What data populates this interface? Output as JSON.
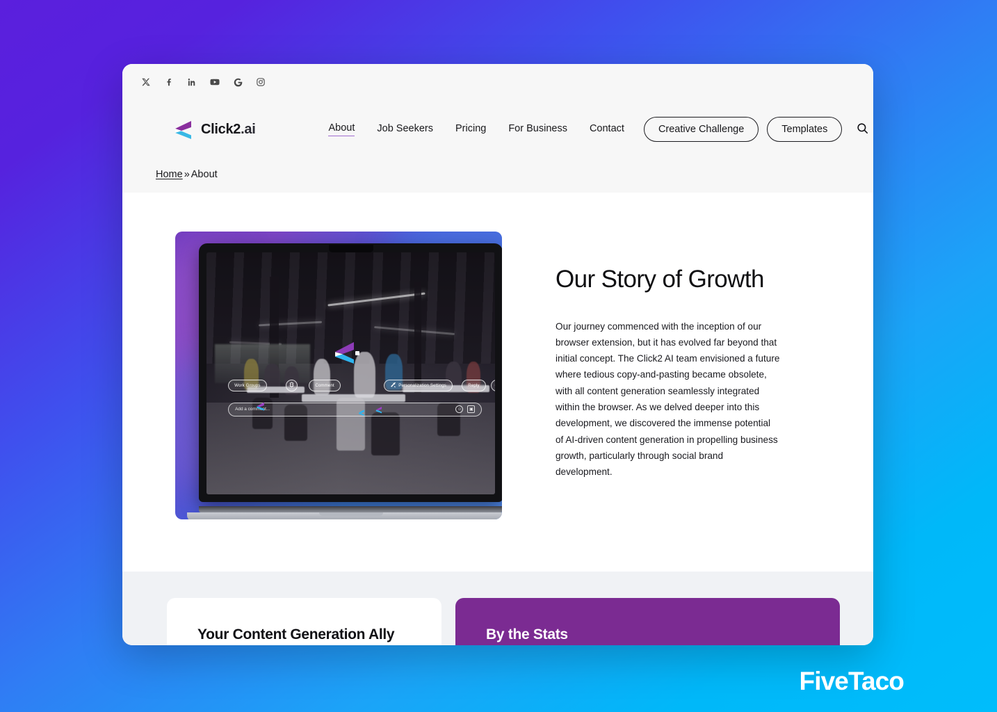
{
  "background": {
    "gradient_from": "#5b1fdd",
    "gradient_mid": "#2f7ef4",
    "gradient_to": "#00bdfb"
  },
  "watermark": {
    "text": "FiveTaco"
  },
  "header": {
    "background": "#f7f7f7",
    "social_links": [
      {
        "name": "x-twitter",
        "label": "X"
      },
      {
        "name": "facebook",
        "label": "Facebook"
      },
      {
        "name": "linkedin",
        "label": "LinkedIn"
      },
      {
        "name": "youtube",
        "label": "YouTube"
      },
      {
        "name": "google",
        "label": "Google"
      },
      {
        "name": "instagram",
        "label": "Instagram"
      }
    ],
    "brand": {
      "name_main": "Click2",
      "name_suffix": ".ai",
      "mark_purple": "#8a2f9e",
      "mark_cyan": "#39b8e5"
    },
    "nav_links": [
      {
        "label": "About",
        "active": true
      },
      {
        "label": "Job Seekers",
        "active": false
      },
      {
        "label": "Pricing",
        "active": false
      },
      {
        "label": "For Business",
        "active": false
      },
      {
        "label": "Contact",
        "active": false
      }
    ],
    "nav_buttons": [
      {
        "label": "Creative Challenge"
      },
      {
        "label": "Templates"
      }
    ],
    "search_icon": "search-icon",
    "active_underline_color": "#a06cd0"
  },
  "breadcrumb": {
    "home": "Home",
    "separator": "»",
    "current": "About"
  },
  "hero": {
    "title": "Our Story of Growth",
    "paragraph": "Our journey commenced with the inception of our browser extension, but it has evolved far beyond that initial concept. The Click2 AI team envisioned a future where tedious copy-and-pasting became obsolete, with all content generation seamlessly integrated within the browser. As we delved deeper into this development, we discovered the immense potential of AI-driven content generation in propelling business growth, particularly through social brand development.",
    "mockup": {
      "alt": "Laptop showing the Click2.ai extension overlaid on a dark open-plan office photo",
      "overlay_pills": [
        {
          "label": "Work Groups"
        },
        {
          "label": "",
          "icon": "puzzle-icon"
        },
        {
          "label": "Comment"
        },
        {
          "label": "Personalization Settings",
          "icon": "tools-icon"
        },
        {
          "label": "Reply"
        },
        {
          "label": "",
          "icon": "more-icon"
        }
      ],
      "comment_input_placeholder": "Add a comment...",
      "comment_actions": [
        {
          "name": "emoji-icon",
          "glyph": "☺"
        },
        {
          "name": "image-icon",
          "glyph": "▣"
        }
      ]
    }
  },
  "cards": [
    {
      "title": "Your Content Generation Ally",
      "style": "light",
      "background": "#ffffff"
    },
    {
      "title": "By the Stats",
      "style": "purple",
      "background": "#7b2b92"
    }
  ]
}
